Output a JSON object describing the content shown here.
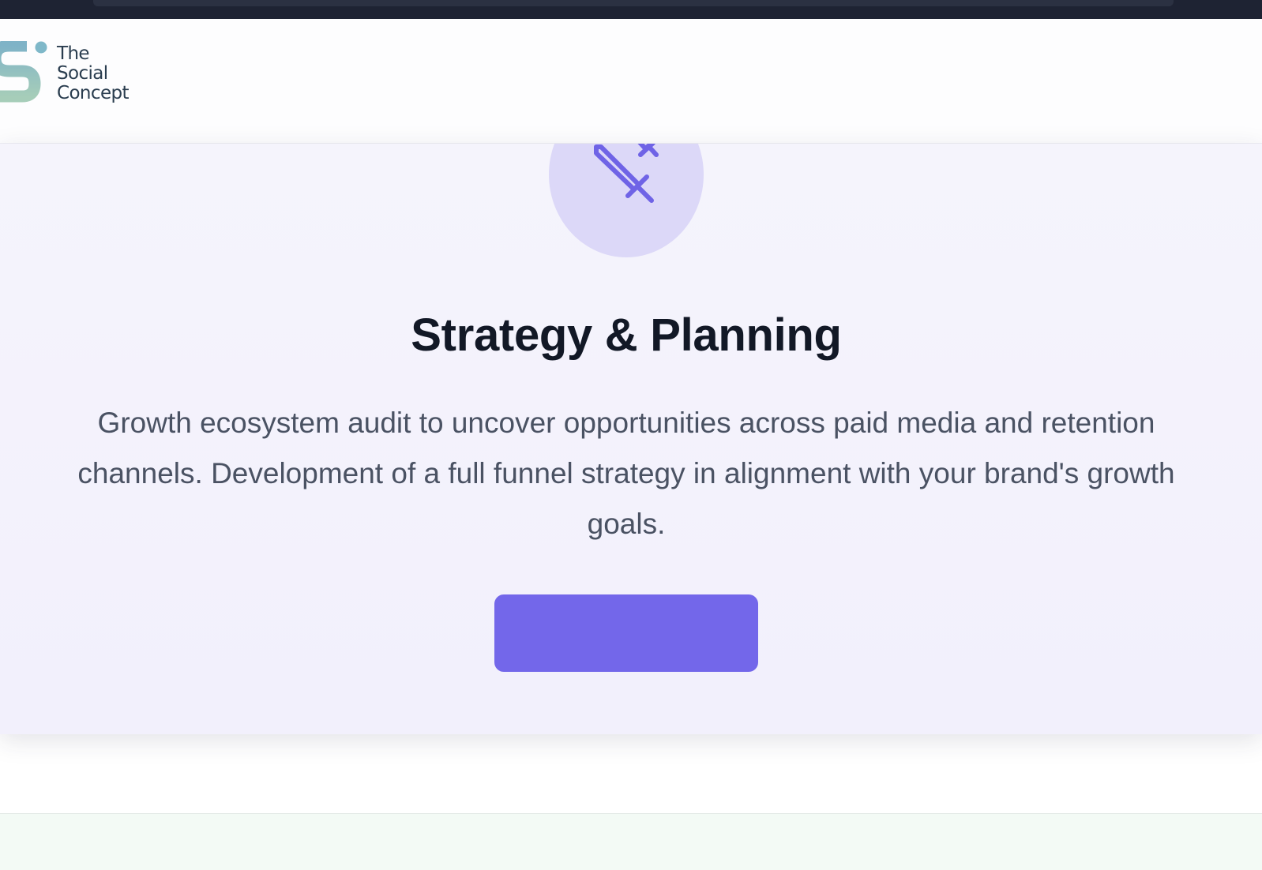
{
  "brand": {
    "logo_lines": [
      "The",
      "Social",
      "Concept"
    ],
    "accent_color": "#7367ea",
    "icon_circle_color": "#dcd8f8",
    "logo_color": "#8fbfbf"
  },
  "service": {
    "icon": "sword-icon",
    "title": "Strategy & Planning",
    "description": "Growth ecosystem audit to uncover opportunities across paid media and retention channels. Development of a full funnel strategy in alignment with your brand's growth goals.",
    "button_label": ""
  }
}
